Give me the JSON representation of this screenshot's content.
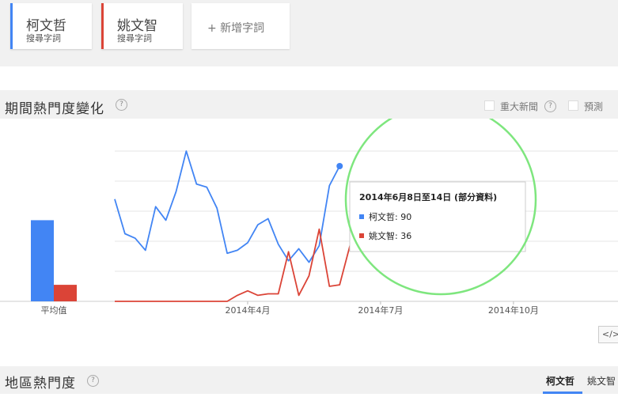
{
  "terms": [
    {
      "name": "柯文哲",
      "sub": "搜尋字詞",
      "color": "#4285f4"
    },
    {
      "name": "姚文智",
      "sub": "搜尋字詞",
      "color": "#db4437"
    }
  ],
  "add_term": "+ 新增字詞",
  "interest_section": {
    "title": "期間熱門度變化",
    "help": "?",
    "headlines_label": "重大新聞",
    "forecast_label": "預測"
  },
  "tooltip": {
    "title": "2014年6月8日至14日 (部分資料)",
    "rows": [
      {
        "label": "柯文哲: 90",
        "color": "#4285f4"
      },
      {
        "label": "姚文智: 36",
        "color": "#db4437"
      }
    ]
  },
  "chart_data": {
    "type": "line",
    "average_bars": {
      "label": "平均值",
      "values": [
        {
          "name": "柯文哲",
          "value": 54,
          "color": "#4285f4"
        },
        {
          "name": "姚文智",
          "value": 11,
          "color": "#db4437"
        }
      ]
    },
    "x_ticks": [
      "2014年4月",
      "2014年7月",
      "2014年10月"
    ],
    "x_tick_week": [
      13,
      26,
      39
    ],
    "ylim": [
      0,
      100
    ],
    "series": [
      {
        "name": "柯文哲",
        "color": "#4285f4",
        "values": [
          68,
          45,
          42,
          34,
          63,
          54,
          73,
          100,
          78,
          76,
          62,
          32,
          34,
          39,
          51,
          55,
          38,
          27,
          35,
          26,
          37,
          77,
          90
        ]
      },
      {
        "name": "姚文智",
        "color": "#db4437",
        "values": [
          0,
          0,
          0,
          0,
          0,
          0,
          0,
          0,
          0,
          0,
          0,
          0,
          4,
          7,
          4,
          5,
          5,
          33,
          4,
          17,
          48,
          10,
          11,
          37,
          36
        ]
      }
    ],
    "series_start_week": [
      0,
      0
    ],
    "highlight_week": 23
  },
  "annotation_color": "#7ee67e",
  "embed_label": "</>",
  "region_section": {
    "title": "地區熱門度",
    "help": "?",
    "tabs": [
      "柯文哲",
      "姚文智"
    ]
  }
}
